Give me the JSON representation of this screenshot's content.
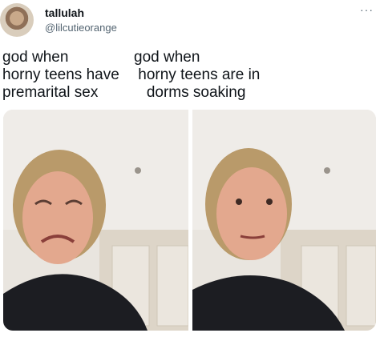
{
  "tweet": {
    "display_name": "tallulah",
    "handle": "@lilcutieorange",
    "more_icon": "more-icon",
    "caption_left": "god when\nhorny teens have\npremarital sex",
    "caption_right": "god when\n horny teens are in\n   dorms soaking"
  },
  "media": [
    {
      "expression": "grimacing",
      "icon": "photo"
    },
    {
      "expression": "neutral",
      "icon": "photo"
    }
  ]
}
